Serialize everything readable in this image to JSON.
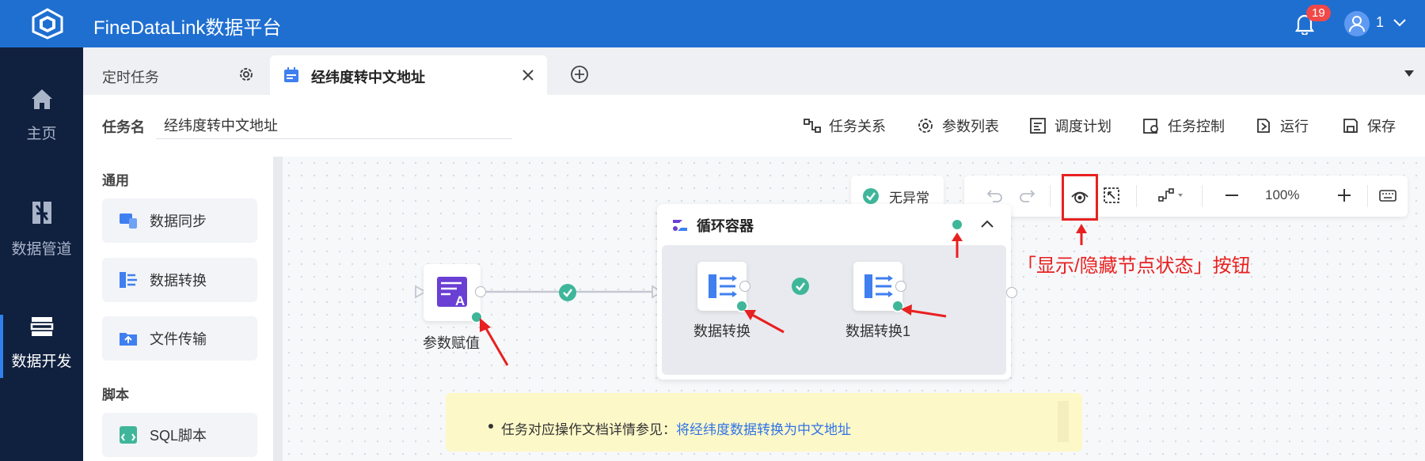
{
  "app": {
    "title": "FineDataLink数据平台"
  },
  "header": {
    "notification_count": "19",
    "user_name": "1"
  },
  "nav": {
    "items": [
      {
        "label": "主页",
        "icon": "home-icon"
      },
      {
        "label": "数据管道",
        "icon": "pipeline-icon"
      },
      {
        "label": "数据开发",
        "icon": "dev-icon",
        "active": true
      }
    ]
  },
  "tabs": [
    {
      "label": "定时任务"
    },
    {
      "label": "经纬度转中文地址",
      "active": true
    }
  ],
  "toolbar": {
    "task_name_label": "任务名",
    "task_name_value": "经纬度转中文地址",
    "buttons": [
      "任务关系",
      "参数列表",
      "调度计划",
      "任务控制",
      "运行",
      "保存"
    ]
  },
  "panel": {
    "section_general": "通用",
    "items_general": [
      "数据同步",
      "数据转换",
      "文件传输"
    ],
    "section_script": "脚本",
    "items_script": [
      "SQL脚本"
    ]
  },
  "canvas": {
    "status_label": "无异常",
    "zoom": "100%",
    "container_title": "循环容器",
    "nodes": [
      "参数赋值",
      "数据转换",
      "数据转换1"
    ],
    "annotation": "「显示/隐藏节点状态」按钮"
  },
  "notice": {
    "prefix": "任务对应操作文档详情参见：",
    "link": "将经纬度数据转换为中文地址"
  },
  "colors": {
    "topbar": "#1f6fd1",
    "nav": "#10203f",
    "success": "#3fb69a",
    "annotation": "#e82020",
    "link": "#2f73e8"
  }
}
